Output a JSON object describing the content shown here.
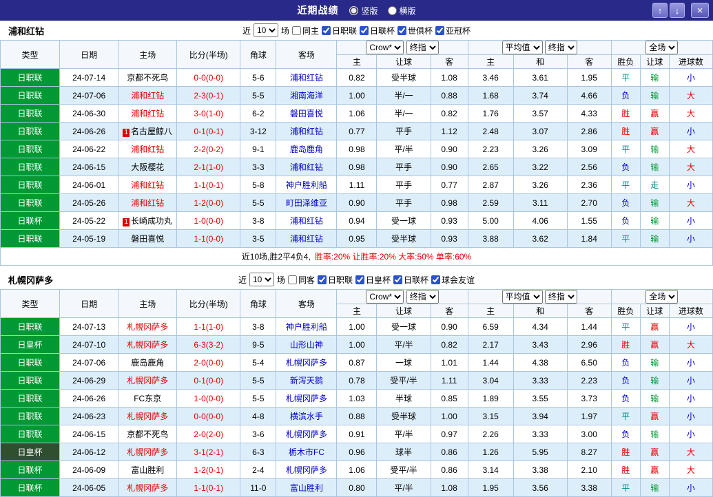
{
  "topbar": {
    "title": "近期战绩",
    "view_modes": [
      {
        "label": "竖版",
        "selected": true
      },
      {
        "label": "横版",
        "selected": false
      }
    ],
    "icons": {
      "up": "↑",
      "down": "↓",
      "close": "×"
    }
  },
  "filter_labels": {
    "near": "近",
    "matches": "场"
  },
  "table_head": {
    "col_type": "类型",
    "col_date": "日期",
    "col_home": "主场",
    "col_score": "比分(半场)",
    "col_corner": "角球",
    "col_away": "客场",
    "odds_select": "Crow*",
    "odds_time_select": "终指",
    "avg_select": "平均值",
    "avg_time_select": "终指",
    "scope_select": "全场",
    "sub_home": "主",
    "sub_handicap": "让球",
    "sub_away": "客",
    "sub_avg_home": "主",
    "sub_avg_draw": "和",
    "sub_avg_away": "客",
    "col_result": "胜负",
    "col_handicap_result": "让球",
    "col_goals": "进球数"
  },
  "palette": {
    "topbar_bg": "#29298a",
    "grid_border": "#a9c5e2",
    "row_alt": "#ddeefb",
    "type_green": "#009933",
    "type_dark": "#2f4f2f",
    "focal_team_red": "#e60000",
    "away_team_blue": "#0000cc",
    "score_red": "#e60000"
  },
  "result_colors": {
    "胜": "#e60000",
    "平": "#008888",
    "负": "#0000cc",
    "赢": "#e60000",
    "走": "#008888",
    "输": "#009933",
    "大": "#e60000",
    "小": "#0000cc"
  },
  "sections": [
    {
      "team": "浦和红钻",
      "filter": {
        "count": "10",
        "venue": {
          "label": "同主",
          "checked": false
        },
        "leagues": [
          {
            "label": "日职联",
            "checked": true
          },
          {
            "label": "日联杯",
            "checked": true
          },
          {
            "label": "世俱杯",
            "checked": true
          },
          {
            "label": "亚冠杯",
            "checked": true
          }
        ]
      },
      "rows": [
        {
          "type": "日职联",
          "type_bg": "#009933",
          "date": "24-07-14",
          "home": "京都不死鸟",
          "home_color": "#000000",
          "score": "0-0(0-0)",
          "corner": "5-6",
          "away": "浦和红钻",
          "o_home": "0.82",
          "o_hcap": "受半球",
          "o_away": "1.08",
          "a_home": "3.46",
          "a_draw": "3.61",
          "a_away": "1.95",
          "result": "平",
          "hcap_res": "输",
          "goals": "小"
        },
        {
          "type": "日职联",
          "type_bg": "#009933",
          "date": "24-07-06",
          "home": "浦和红钻",
          "home_color": "#e60000",
          "score": "2-3(0-1)",
          "corner": "5-5",
          "away": "湘南海洋",
          "o_home": "1.00",
          "o_hcap": "半/一",
          "o_away": "0.88",
          "a_home": "1.68",
          "a_draw": "3.74",
          "a_away": "4.66",
          "result": "负",
          "hcap_res": "输",
          "goals": "大"
        },
        {
          "type": "日职联",
          "type_bg": "#009933",
          "date": "24-06-30",
          "home": "浦和红钻",
          "home_color": "#e60000",
          "score": "3-0(1-0)",
          "corner": "6-2",
          "away": "磐田喜悦",
          "o_home": "1.06",
          "o_hcap": "半/一",
          "o_away": "0.82",
          "a_home": "1.76",
          "a_draw": "3.57",
          "a_away": "4.33",
          "result": "胜",
          "hcap_res": "赢",
          "goals": "大"
        },
        {
          "type": "日职联",
          "type_bg": "#009933",
          "date": "24-06-26",
          "home": "名古屋鲸八",
          "home_badge": "1",
          "home_color": "#000000",
          "score": "0-1(0-1)",
          "corner": "3-12",
          "away": "浦和红钻",
          "o_home": "0.77",
          "o_hcap": "平手",
          "o_away": "1.12",
          "a_home": "2.48",
          "a_draw": "3.07",
          "a_away": "2.86",
          "result": "胜",
          "hcap_res": "赢",
          "goals": "小"
        },
        {
          "type": "日职联",
          "type_bg": "#009933",
          "date": "24-06-22",
          "home": "浦和红钻",
          "home_color": "#e60000",
          "score": "2-2(0-2)",
          "corner": "9-1",
          "away": "鹿岛鹿角",
          "o_home": "0.98",
          "o_hcap": "平/半",
          "o_away": "0.90",
          "a_home": "2.23",
          "a_draw": "3.26",
          "a_away": "3.09",
          "result": "平",
          "hcap_res": "输",
          "goals": "大"
        },
        {
          "type": "日职联",
          "type_bg": "#009933",
          "date": "24-06-15",
          "home": "大阪樱花",
          "home_color": "#000000",
          "score": "2-1(1-0)",
          "corner": "3-3",
          "away": "浦和红钻",
          "o_home": "0.98",
          "o_hcap": "平手",
          "o_away": "0.90",
          "a_home": "2.65",
          "a_draw": "3.22",
          "a_away": "2.56",
          "result": "负",
          "hcap_res": "输",
          "goals": "大"
        },
        {
          "type": "日职联",
          "type_bg": "#009933",
          "date": "24-06-01",
          "home": "浦和红钻",
          "home_color": "#e60000",
          "score": "1-1(0-1)",
          "corner": "5-8",
          "away": "神户胜利船",
          "o_home": "1.11",
          "o_hcap": "平手",
          "o_away": "0.77",
          "a_home": "2.87",
          "a_draw": "3.26",
          "a_away": "2.36",
          "result": "平",
          "hcap_res": "走",
          "goals": "小"
        },
        {
          "type": "日职联",
          "type_bg": "#009933",
          "date": "24-05-26",
          "home": "浦和红钻",
          "home_color": "#e60000",
          "score": "1-2(0-0)",
          "corner": "5-5",
          "away": "町田泽维亚",
          "o_home": "0.90",
          "o_hcap": "平手",
          "o_away": "0.98",
          "a_home": "2.59",
          "a_draw": "3.11",
          "a_away": "2.70",
          "result": "负",
          "hcap_res": "输",
          "goals": "大"
        },
        {
          "type": "日联杯",
          "type_bg": "#009933",
          "date": "24-05-22",
          "home": "长崎成功丸",
          "home_badge": "1",
          "home_color": "#000000",
          "score": "1-0(0-0)",
          "corner": "3-8",
          "away": "浦和红钻",
          "o_home": "0.94",
          "o_hcap": "受一球",
          "o_away": "0.93",
          "a_home": "5.00",
          "a_draw": "4.06",
          "a_away": "1.55",
          "result": "负",
          "hcap_res": "输",
          "goals": "小"
        },
        {
          "type": "日职联",
          "type_bg": "#009933",
          "date": "24-05-19",
          "home": "磐田喜悦",
          "home_color": "#000000",
          "score": "1-1(0-0)",
          "corner": "3-5",
          "away": "浦和红钻",
          "o_home": "0.95",
          "o_hcap": "受半球",
          "o_away": "0.93",
          "a_home": "3.88",
          "a_draw": "3.62",
          "a_away": "1.84",
          "result": "平",
          "hcap_res": "输",
          "goals": "小"
        }
      ],
      "summary": {
        "record": "近10场,胜2平4负4,",
        "stats": "胜率:20% 让胜率:20% 大率:50% 单率:60%"
      }
    },
    {
      "team": "札幌冈萨多",
      "filter": {
        "count": "10",
        "venue": {
          "label": "同客",
          "checked": false
        },
        "leagues": [
          {
            "label": "日职联",
            "checked": true
          },
          {
            "label": "日皇杯",
            "checked": true
          },
          {
            "label": "日联杯",
            "checked": true
          },
          {
            "label": "球会友谊",
            "checked": true
          }
        ]
      },
      "rows": [
        {
          "type": "日职联",
          "type_bg": "#009933",
          "date": "24-07-13",
          "home": "札幌冈萨多",
          "home_color": "#e60000",
          "score": "1-1(1-0)",
          "corner": "3-8",
          "away": "神户胜利船",
          "o_home": "1.00",
          "o_hcap": "受一球",
          "o_away": "0.90",
          "a_home": "6.59",
          "a_draw": "4.34",
          "a_away": "1.44",
          "result": "平",
          "hcap_res": "赢",
          "goals": "小"
        },
        {
          "type": "日皇杯",
          "type_bg": "#009933",
          "date": "24-07-10",
          "home": "札幌冈萨多",
          "home_color": "#e60000",
          "score": "6-3(3-2)",
          "corner": "9-5",
          "away": "山形山神",
          "o_home": "1.00",
          "o_hcap": "平/半",
          "o_away": "0.82",
          "a_home": "2.17",
          "a_draw": "3.43",
          "a_away": "2.96",
          "result": "胜",
          "hcap_res": "赢",
          "goals": "大"
        },
        {
          "type": "日职联",
          "type_bg": "#009933",
          "date": "24-07-06",
          "home": "鹿岛鹿角",
          "home_color": "#000000",
          "score": "2-0(0-0)",
          "corner": "5-4",
          "away": "札幌冈萨多",
          "o_home": "0.87",
          "o_hcap": "一球",
          "o_away": "1.01",
          "a_home": "1.44",
          "a_draw": "4.38",
          "a_away": "6.50",
          "result": "负",
          "hcap_res": "输",
          "goals": "小"
        },
        {
          "type": "日职联",
          "type_bg": "#009933",
          "date": "24-06-29",
          "home": "札幌冈萨多",
          "home_color": "#e60000",
          "score": "0-1(0-0)",
          "corner": "5-5",
          "away": "新泻天鹅",
          "o_home": "0.78",
          "o_hcap": "受平/半",
          "o_away": "1.11",
          "a_home": "3.04",
          "a_draw": "3.33",
          "a_away": "2.23",
          "result": "负",
          "hcap_res": "输",
          "goals": "小"
        },
        {
          "type": "日职联",
          "type_bg": "#009933",
          "date": "24-06-26",
          "home": "FC东京",
          "home_color": "#000000",
          "score": "1-0(0-0)",
          "corner": "5-5",
          "away": "札幌冈萨多",
          "o_home": "1.03",
          "o_hcap": "半球",
          "o_away": "0.85",
          "a_home": "1.89",
          "a_draw": "3.55",
          "a_away": "3.73",
          "result": "负",
          "hcap_res": "输",
          "goals": "小"
        },
        {
          "type": "日职联",
          "type_bg": "#009933",
          "date": "24-06-23",
          "home": "札幌冈萨多",
          "home_color": "#e60000",
          "score": "0-0(0-0)",
          "corner": "4-8",
          "away": "横滨水手",
          "o_home": "0.88",
          "o_hcap": "受半球",
          "o_away": "1.00",
          "a_home": "3.15",
          "a_draw": "3.94",
          "a_away": "1.97",
          "result": "平",
          "hcap_res": "赢",
          "goals": "小"
        },
        {
          "type": "日职联",
          "type_bg": "#009933",
          "date": "24-06-15",
          "home": "京都不死鸟",
          "home_color": "#000000",
          "score": "2-0(2-0)",
          "corner": "3-6",
          "away": "札幌冈萨多",
          "o_home": "0.91",
          "o_hcap": "平/半",
          "o_away": "0.97",
          "a_home": "2.26",
          "a_draw": "3.33",
          "a_away": "3.00",
          "result": "负",
          "hcap_res": "输",
          "goals": "小"
        },
        {
          "type": "日皇杯",
          "type_bg": "#2f4f2f",
          "date": "24-06-12",
          "home": "札幌冈萨多",
          "home_color": "#e60000",
          "score": "3-1(2-1)",
          "corner": "6-3",
          "away": "栃木市FC",
          "o_home": "0.96",
          "o_hcap": "球半",
          "o_away": "0.86",
          "a_home": "1.26",
          "a_draw": "5.95",
          "a_away": "8.27",
          "result": "胜",
          "hcap_res": "赢",
          "goals": "大"
        },
        {
          "type": "日联杯",
          "type_bg": "#009933",
          "date": "24-06-09",
          "home": "富山胜利",
          "home_color": "#000000",
          "score": "1-2(0-1)",
          "corner": "2-4",
          "away": "札幌冈萨多",
          "o_home": "1.06",
          "o_hcap": "受平/半",
          "o_away": "0.86",
          "a_home": "3.14",
          "a_draw": "3.38",
          "a_away": "2.10",
          "result": "胜",
          "hcap_res": "赢",
          "goals": "大"
        },
        {
          "type": "日联杯",
          "type_bg": "#009933",
          "date": "24-06-05",
          "home": "札幌冈萨多",
          "home_color": "#e60000",
          "score": "1-1(0-1)",
          "corner": "11-0",
          "away": "富山胜利",
          "o_home": "0.80",
          "o_hcap": "平/半",
          "o_away": "1.08",
          "a_home": "1.95",
          "a_draw": "3.56",
          "a_away": "3.38",
          "result": "平",
          "hcap_res": "输",
          "goals": "小"
        }
      ]
    }
  ]
}
